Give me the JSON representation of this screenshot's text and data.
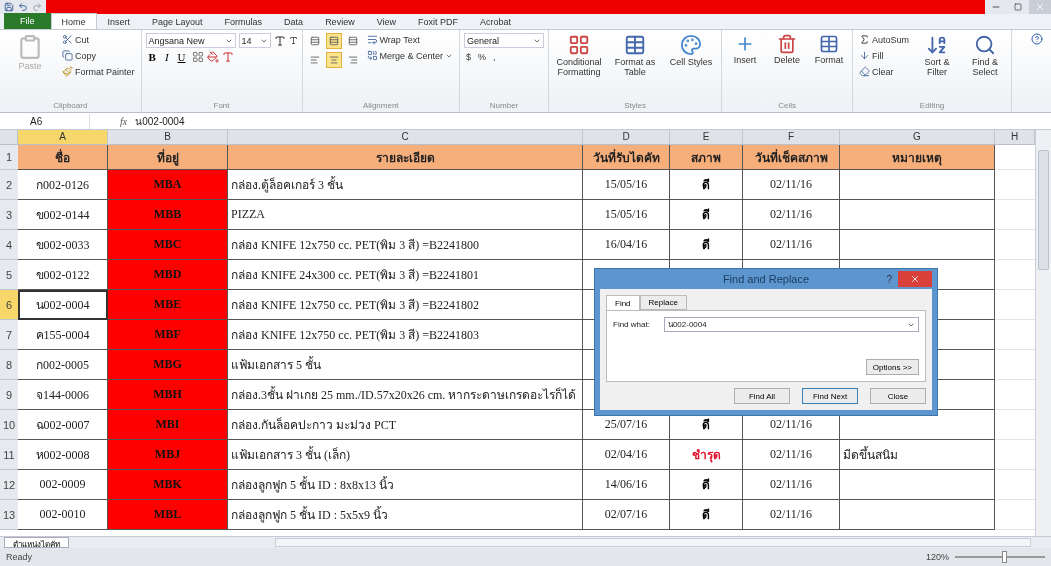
{
  "file_tab": "File",
  "tabs": [
    {
      "label": "Home",
      "selected": true
    },
    {
      "label": "Insert",
      "selected": false
    },
    {
      "label": "Page Layout",
      "selected": false
    },
    {
      "label": "Formulas",
      "selected": false
    },
    {
      "label": "Data",
      "selected": false
    },
    {
      "label": "Review",
      "selected": false
    },
    {
      "label": "View",
      "selected": false
    },
    {
      "label": "Foxit PDF",
      "selected": false
    },
    {
      "label": "Acrobat",
      "selected": false
    }
  ],
  "ribbon": {
    "clipboard": {
      "paste": {
        "label": "Paste",
        "disabled": true
      },
      "cut": "Cut",
      "copy": "Copy",
      "format_painter": "Format Painter",
      "label": "Clipboard"
    },
    "font": {
      "name": "Angsana New",
      "size": "14",
      "bold": "B",
      "italic": "I",
      "underline": "U",
      "label": "Font"
    },
    "alignment": {
      "vertical": [
        {
          "selected": false
        },
        {
          "selected": true
        },
        {
          "selected": false
        }
      ],
      "horizontal": [
        {
          "selected": false
        },
        {
          "selected": true
        },
        {
          "selected": false
        }
      ],
      "wrap": "Wrap Text",
      "merge": "Merge & Center",
      "label": "Alignment"
    },
    "number": {
      "format": "General",
      "currency": "$",
      "percent": "%",
      "comma": ",",
      "label": "Number"
    },
    "styles": {
      "items": [
        "Conditional Formatting",
        "Format as Table",
        "Cell Styles"
      ],
      "label": "Styles"
    },
    "cells": {
      "items": [
        "Insert",
        "Delete",
        "Format"
      ],
      "label": "Cells"
    },
    "editing": {
      "autosum": "AutoSum",
      "fill": "Fill",
      "clear": "Clear",
      "sort": "Sort & Filter",
      "find": "Find & Select",
      "label": "Editing"
    }
  },
  "formula_bar": {
    "name_box": "A6",
    "fx": "fx",
    "value": "น002-0004"
  },
  "columns": [
    "A",
    "B",
    "C",
    "D",
    "E",
    "F",
    "G",
    "H"
  ],
  "header_row": {
    "number": "1",
    "cells": [
      "ชื่อ",
      "ที่อยู่",
      "รายละเอียด",
      "วันที่รับไดคัท",
      "สภาพ",
      "วันที่เช็คสภาพ",
      "หมายเหตุ"
    ]
  },
  "rows": [
    {
      "number": "2",
      "selected": false,
      "code": "ก002-0126",
      "location": "MBA",
      "detail": "กล่อง.ตู้ล็อคเกอร์ 3 ชั้น",
      "received": "15/05/16",
      "condition": {
        "text": "ดี",
        "color": "#000000"
      },
      "checked_date": "02/11/16"
    },
    {
      "number": "3",
      "selected": false,
      "code": "ข002-0144",
      "location": "MBB",
      "detail": "PIZZA",
      "received": "15/05/16",
      "condition": {
        "text": "ดี",
        "color": "#000000"
      },
      "checked_date": "02/11/16"
    },
    {
      "number": "4",
      "selected": false,
      "code": "ข002-0033",
      "location": "MBC",
      "detail": "กล่อง KNIFE 12x750 cc. PET(พิม 3 สี) =B2241800",
      "received": "16/04/16",
      "condition": {
        "text": "ดี",
        "color": "#000000"
      },
      "checked_date": "02/11/16"
    },
    {
      "number": "5",
      "selected": false,
      "code": "ข002-0122",
      "location": "MBD",
      "detail": "กล่อง KNIFE 24x300 cc. PET(พิม 3 สี) =B2241801"
    },
    {
      "number": "6",
      "selected": true,
      "code": "น002-0004",
      "location": "MBE",
      "detail": "กล่อง KNIFE 12x750 cc. PET(พิม 3 สี) =B2241802"
    },
    {
      "number": "7",
      "selected": false,
      "code": "ค155-0004",
      "location": "MBF",
      "detail": "กล่อง KNIFE 12x750 cc. PET(พิม 3 สี) =B2241803"
    },
    {
      "number": "8",
      "selected": false,
      "code": "ก002-0005",
      "location": "MBG",
      "detail": "แฟ้มเอกสาร 5 ชั้น"
    },
    {
      "number": "9",
      "selected": false,
      "code": "จ144-0006",
      "location": "MBH",
      "detail": "กล่อง.3ชั้น ฝาเกย 25 mm./ID.57x20x26 cm. หากระดาษเกรดอะไรก็ได้"
    },
    {
      "number": "10",
      "selected": false,
      "code": "ฉ002-0007",
      "location": "MBI",
      "detail": "กล่อง.กันล็อคปะกาว มะม่วง PCT",
      "received": "25/07/16",
      "condition": {
        "text": "ดี",
        "color": "#000000"
      },
      "checked_date": "02/11/16"
    },
    {
      "number": "11",
      "selected": false,
      "code": "ห002-0008",
      "location": "MBJ",
      "detail": "แฟ้มเอกสาร 3 ชั้น (เล็ก)",
      "received": "02/04/16",
      "condition": {
        "text": "ชำรุด",
        "color": "#e0102a"
      },
      "checked_date": "02/11/16",
      "note": "มีดขึ้นสนิม"
    },
    {
      "number": "12",
      "selected": false,
      "code": "002-0009",
      "location": "MBK",
      "detail": "กล่องลูกฟูก 5 ชั้น ID : 8x8x13 นิ้ว",
      "received": "14/06/16",
      "condition": {
        "text": "ดี",
        "color": "#000000"
      },
      "checked_date": "02/11/16"
    },
    {
      "number": "13",
      "selected": false,
      "code": "002-0010",
      "location": "MBL",
      "detail": "กล่องลูกฟูก 5 ชั้น ID : 5x5x9 นิ้ว",
      "received": "02/07/16",
      "condition": {
        "text": "ดี",
        "color": "#000000"
      },
      "checked_date": "02/11/16"
    }
  ],
  "dialog": {
    "title": "Find and Replace",
    "help": "?",
    "tabs": [
      {
        "label": "Find",
        "selected": true
      },
      {
        "label": "Replace",
        "selected": false
      }
    ],
    "field_label": "Find what:",
    "field_value": "น002-0004",
    "options": "Options >>",
    "buttons": [
      {
        "label": "Find All",
        "default": false
      },
      {
        "label": "Find Next",
        "default": true
      },
      {
        "label": "Close",
        "default": false
      }
    ]
  },
  "sheet_tabs": [
    {
      "label": "ตำแหน่งไดคัท",
      "selected": true
    }
  ],
  "status_bar": {
    "text": "Ready",
    "zoom": "120%",
    "zoom_slider": {
      "level": 0.55
    }
  }
}
